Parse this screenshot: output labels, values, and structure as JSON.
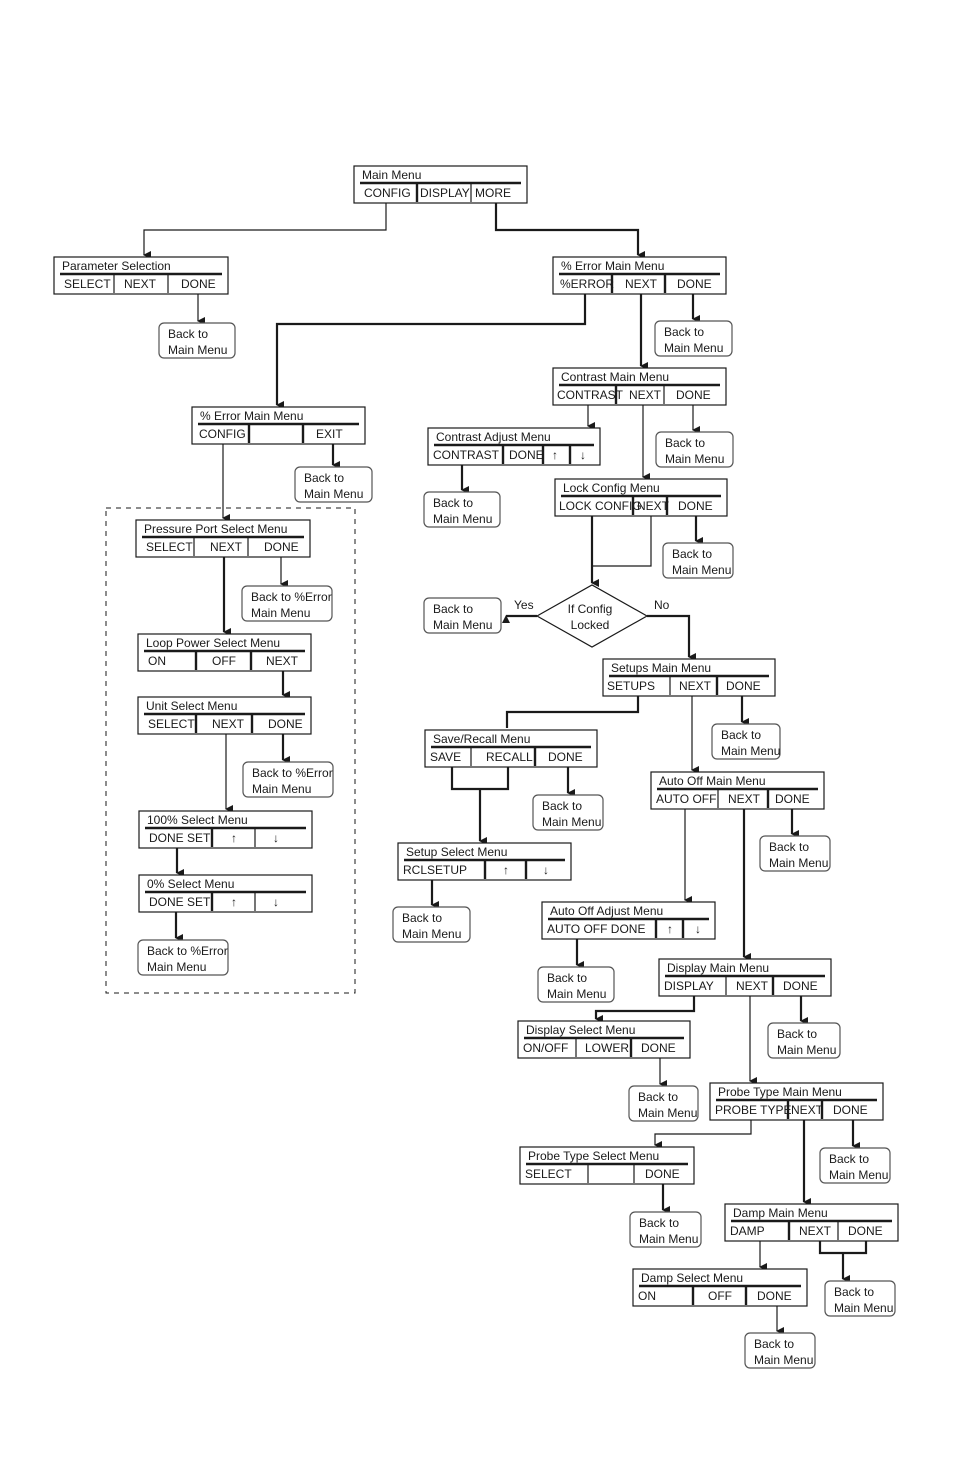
{
  "diagram": {
    "type": "menu-flowchart",
    "back_label_line1": "Back to",
    "back_label_line2": "Main Menu",
    "back_error_line1": "Back to %Error",
    "back_error_line2": "Main Menu",
    "decision": {
      "line1": "If Config",
      "line2": "Locked",
      "yes_label": "Yes",
      "no_label": "No"
    },
    "menus": [
      {
        "id": "main",
        "title": "Main Menu",
        "options": [
          "CONFIG",
          "DISPLAY",
          "MORE"
        ]
      },
      {
        "id": "param",
        "title": "Parameter Selection",
        "options": [
          "SELECT",
          "NEXT",
          "DONE"
        ]
      },
      {
        "id": "err1",
        "title": "% Error Main Menu",
        "options": [
          "%ERROR",
          "NEXT",
          "DONE"
        ]
      },
      {
        "id": "err2",
        "title": "% Error Main Menu",
        "options": [
          "CONFIG",
          "",
          "EXIT"
        ]
      },
      {
        "id": "contrast",
        "title": "Contrast  Main Menu",
        "options": [
          "CONTRAST",
          "NEXT",
          "DONE"
        ]
      },
      {
        "id": "contrastadj",
        "title": "Contrast Adjust Menu",
        "options": [
          "CONTRAST",
          "DONE",
          "↑",
          "↓"
        ]
      },
      {
        "id": "lock",
        "title": "Lock Config  Menu",
        "options": [
          "LOCK CONFIG",
          "NEXT",
          "DONE"
        ]
      },
      {
        "id": "pport",
        "title": "Pressure Port Select Menu",
        "options": [
          "SELECT",
          "NEXT",
          "DONE"
        ]
      },
      {
        "id": "loop",
        "title": "Loop Power Select Menu",
        "options": [
          "ON",
          "OFF",
          "NEXT"
        ]
      },
      {
        "id": "unit",
        "title": "Unit Select Menu",
        "options": [
          "SELECT",
          "NEXT",
          "DONE"
        ]
      },
      {
        "id": "p100",
        "title": "100% Select Menu",
        "options": [
          "DONE SET",
          "↑",
          "↓"
        ]
      },
      {
        "id": "p0",
        "title": "0% Select Menu",
        "options": [
          "DONE SET",
          "↑",
          "↓"
        ]
      },
      {
        "id": "setups",
        "title": "Setups Main Menu",
        "options": [
          "SETUPS",
          "NEXT",
          "DONE"
        ]
      },
      {
        "id": "saverecall",
        "title": "Save/Recall Menu",
        "options": [
          "SAVE",
          "RECALL",
          "DONE"
        ]
      },
      {
        "id": "setupsel",
        "title": "Setup Select Menu",
        "options": [
          "RCLSETUP",
          "↑",
          "↓"
        ]
      },
      {
        "id": "autooff",
        "title": "Auto Off Main Menu",
        "options": [
          "AUTO OFF",
          "NEXT",
          "DONE"
        ]
      },
      {
        "id": "autooffadj",
        "title": "Auto Off Adjust Menu",
        "options": [
          "AUTO OFF   DONE",
          "↑",
          "↓"
        ]
      },
      {
        "id": "display",
        "title": "Display Main Menu",
        "options": [
          "DISPLAY",
          "NEXT",
          "DONE"
        ]
      },
      {
        "id": "displaysel",
        "title": "Display Select Menu",
        "options": [
          "ON/OFF",
          "LOWER",
          "DONE"
        ]
      },
      {
        "id": "probe",
        "title": "Probe Type Main Menu",
        "options": [
          "PROBE TYPE",
          "NEXT",
          "DONE"
        ]
      },
      {
        "id": "probesel",
        "title": "Probe Type Select Menu",
        "options": [
          "SELECT",
          "",
          "DONE"
        ]
      },
      {
        "id": "damp",
        "title": "Damp Main Menu",
        "options": [
          "DAMP",
          "NEXT",
          "DONE"
        ]
      },
      {
        "id": "dampsel",
        "title": "Damp Select Menu",
        "options": [
          "ON",
          "OFF",
          "DONE"
        ]
      }
    ]
  }
}
